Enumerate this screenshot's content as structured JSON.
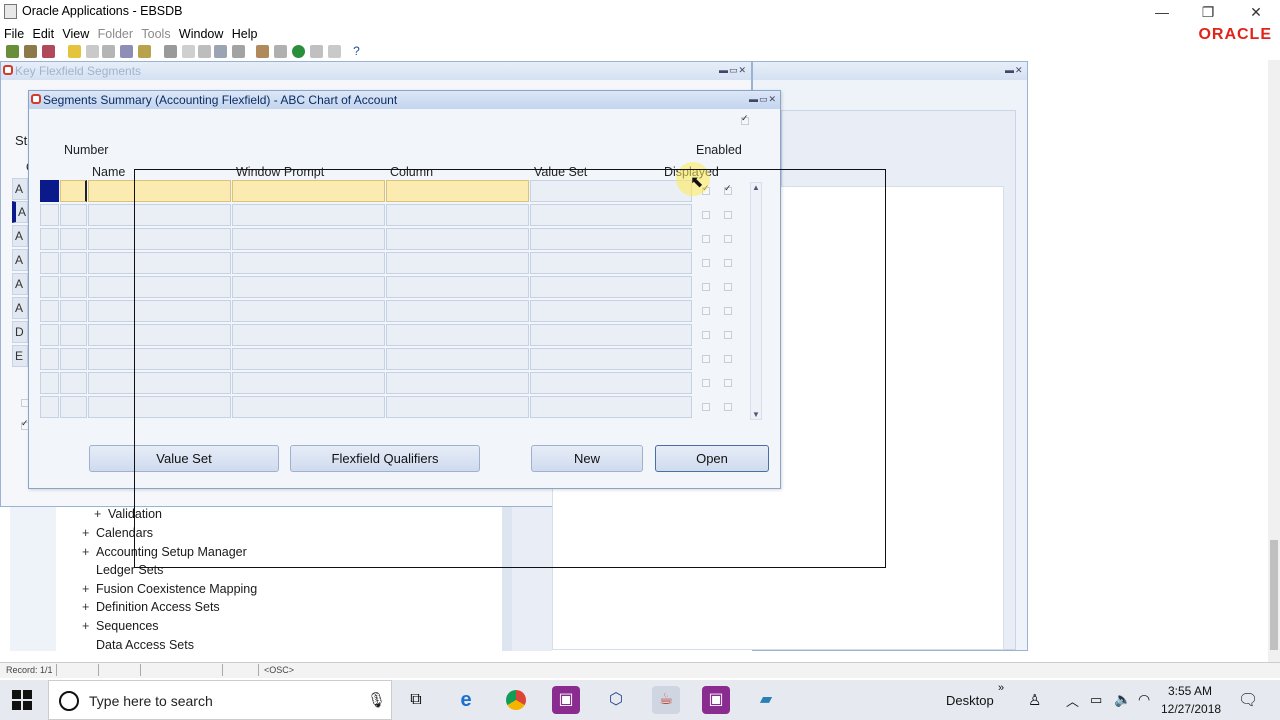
{
  "window": {
    "title": "Oracle Applications - EBSDB",
    "brand": "ORACLE",
    "brand_color": "#e2231a"
  },
  "menu": [
    {
      "label": "File",
      "enabled": true
    },
    {
      "label": "Edit",
      "enabled": true
    },
    {
      "label": "View",
      "enabled": true
    },
    {
      "label": "Folder",
      "enabled": false
    },
    {
      "label": "Tools",
      "enabled": false
    },
    {
      "label": "Window",
      "enabled": true
    },
    {
      "label": "Help",
      "enabled": true
    }
  ],
  "back_window": {
    "title": "Key Flexfield Segments",
    "left_labels": [
      "St",
      "C",
      "A",
      "A",
      "A",
      "A",
      "A",
      "A",
      "D",
      "E"
    ]
  },
  "navigator": {
    "items": [
      {
        "label": "Validation",
        "expander": "+"
      },
      {
        "label": "Calendars",
        "expander": "+"
      },
      {
        "label": "Accounting Setup Manager",
        "expander": "+"
      },
      {
        "label": "Ledger Sets",
        "expander": ""
      },
      {
        "label": "Fusion Coexistence Mapping",
        "expander": "+"
      },
      {
        "label": "Definition Access Sets",
        "expander": "+"
      },
      {
        "label": "Sequences",
        "expander": "+"
      },
      {
        "label": "Data Access Sets",
        "expander": ""
      }
    ]
  },
  "dialog": {
    "title": "Segments Summary (Accounting Flexfield) - ABC Chart of Account",
    "columns": {
      "number": "Number",
      "name": "Name",
      "window_prompt": "Window Prompt",
      "column": "Column",
      "value_set": "Value Set",
      "displayed": "Displayed",
      "enabled": "Enabled"
    },
    "row_count": 10,
    "buttons": {
      "value_set": "Value Set",
      "flexfield_qualifiers": "Flexfield Qualifiers",
      "new": "New",
      "open": "Open"
    }
  },
  "status": {
    "record": "Record: 1/1",
    "osc": "<OSC>"
  },
  "taskbar": {
    "search_placeholder": "Type here to search",
    "desktop_label": "Desktop",
    "time": "3:55 AM",
    "date": "12/27/2018"
  }
}
